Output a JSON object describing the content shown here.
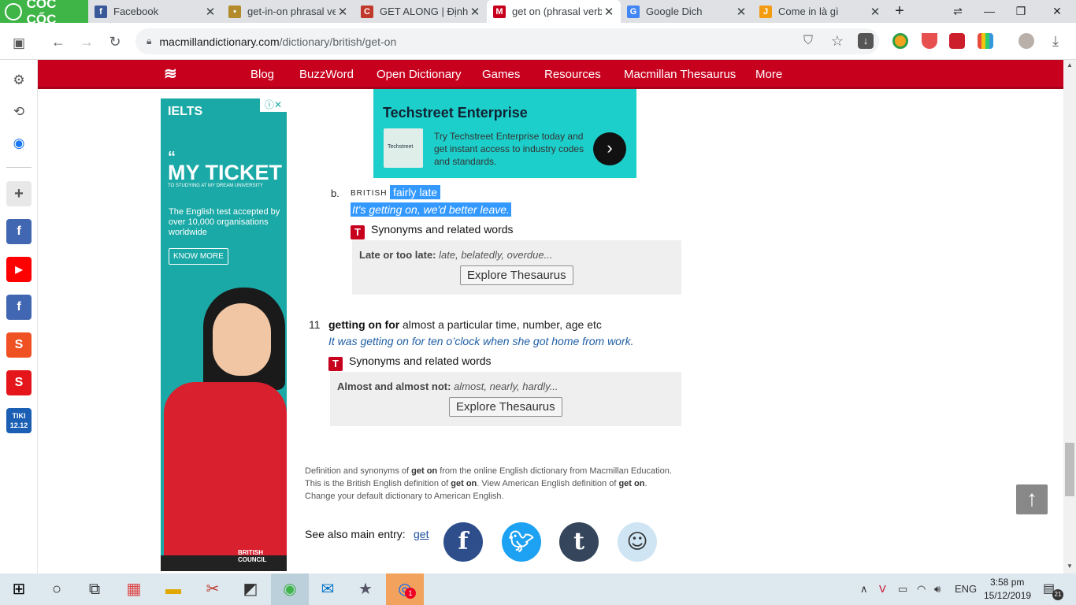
{
  "browser": {
    "brand": "CỐC CỐC",
    "tabs": [
      {
        "title": "Facebook",
        "fav": "f",
        "color": "#3b5998"
      },
      {
        "title": "get-in-on phrasal ver",
        "fav": "•",
        "color": "#b38b2a"
      },
      {
        "title": "GET ALONG | Định ng",
        "fav": "C",
        "color": "#c0392b"
      },
      {
        "title": "get on (phrasal verb)",
        "fav": "M",
        "color": "#c7001e"
      },
      {
        "title": "Google Dich",
        "fav": "G",
        "color": "#4285f4"
      },
      {
        "title": "Come in là gì",
        "fav": "J",
        "color": "#f39c12"
      }
    ],
    "url_domain": "macmillandictionary.com",
    "url_path": "/dictionary/british/get-on"
  },
  "sidebar": {
    "apps": [
      {
        "name": "sidebar-facebook",
        "letter": "f",
        "color": "#4267b2"
      },
      {
        "name": "sidebar-youtube",
        "letter": "▶",
        "color": "#ff0000"
      },
      {
        "name": "sidebar-facebook-2",
        "letter": "f",
        "color": "#4267b2"
      },
      {
        "name": "sidebar-shopee",
        "letter": "S",
        "color": "#f05123"
      },
      {
        "name": "sidebar-sendo",
        "letter": "S",
        "color": "#e4161b"
      },
      {
        "name": "sidebar-tiki",
        "letter": "TIKI",
        "color": "#1a5fb4"
      }
    ]
  },
  "nav": {
    "items": [
      "Blog",
      "BuzzWord",
      "Open Dictionary",
      "Games",
      "Resources",
      "Macmillan Thesaurus",
      "More"
    ]
  },
  "ad_ielts": {
    "brand": "IELTS",
    "headline": "MY TICKET",
    "subline": "TO STUDYING AT MY DREAM UNIVERSITY",
    "blurb": "The English test accepted by over 10,000 organisations worldwide",
    "cta": "KNOW MORE",
    "sponsor": "BRITISH COUNCIL"
  },
  "ad_techstreet": {
    "title": "Techstreet Enterprise",
    "text": "Try Techstreet Enterprise today and get instant access to industry codes and standards.",
    "logo": "Techstreet"
  },
  "sense_b": {
    "marker": "b.",
    "region": "BRITISH",
    "definition": "fairly late",
    "example": "It's getting on, we'd better leave.",
    "syn_label": "Synonyms and related words",
    "thes_head": "Late or too late:",
    "thes_words": "late, belatedly, overdue...",
    "explore": "Explore Thesaurus"
  },
  "sense_11": {
    "number": "11",
    "headword": "getting on for",
    "definition": "almost a particular time, number, age etc",
    "example": "It was getting on for ten o’clock when she got home from work.",
    "syn_label": "Synonyms and related words",
    "thes_head": "Almost and almost not:",
    "thes_words": "almost, nearly, hardly...",
    "explore": "Explore Thesaurus"
  },
  "footer": {
    "line1_a": "Definition and synonyms of ",
    "line1_b": "get on",
    "line1_c": " from the online English dictionary from Macmillan Education.",
    "line2_a": "This is the British English definition of ",
    "line2_b": "get on",
    "line2_c": ". View American English definition of ",
    "line2_d": "get on",
    "line2_e": ".",
    "line3": "Change your default dictionary to American English.",
    "see_also": "See also main entry:",
    "see_also_link": "get"
  },
  "taskbar": {
    "lang": "ENG",
    "time": "3:58 pm",
    "date": "15/12/2019",
    "notif": "21",
    "zalo_badge": "1"
  }
}
